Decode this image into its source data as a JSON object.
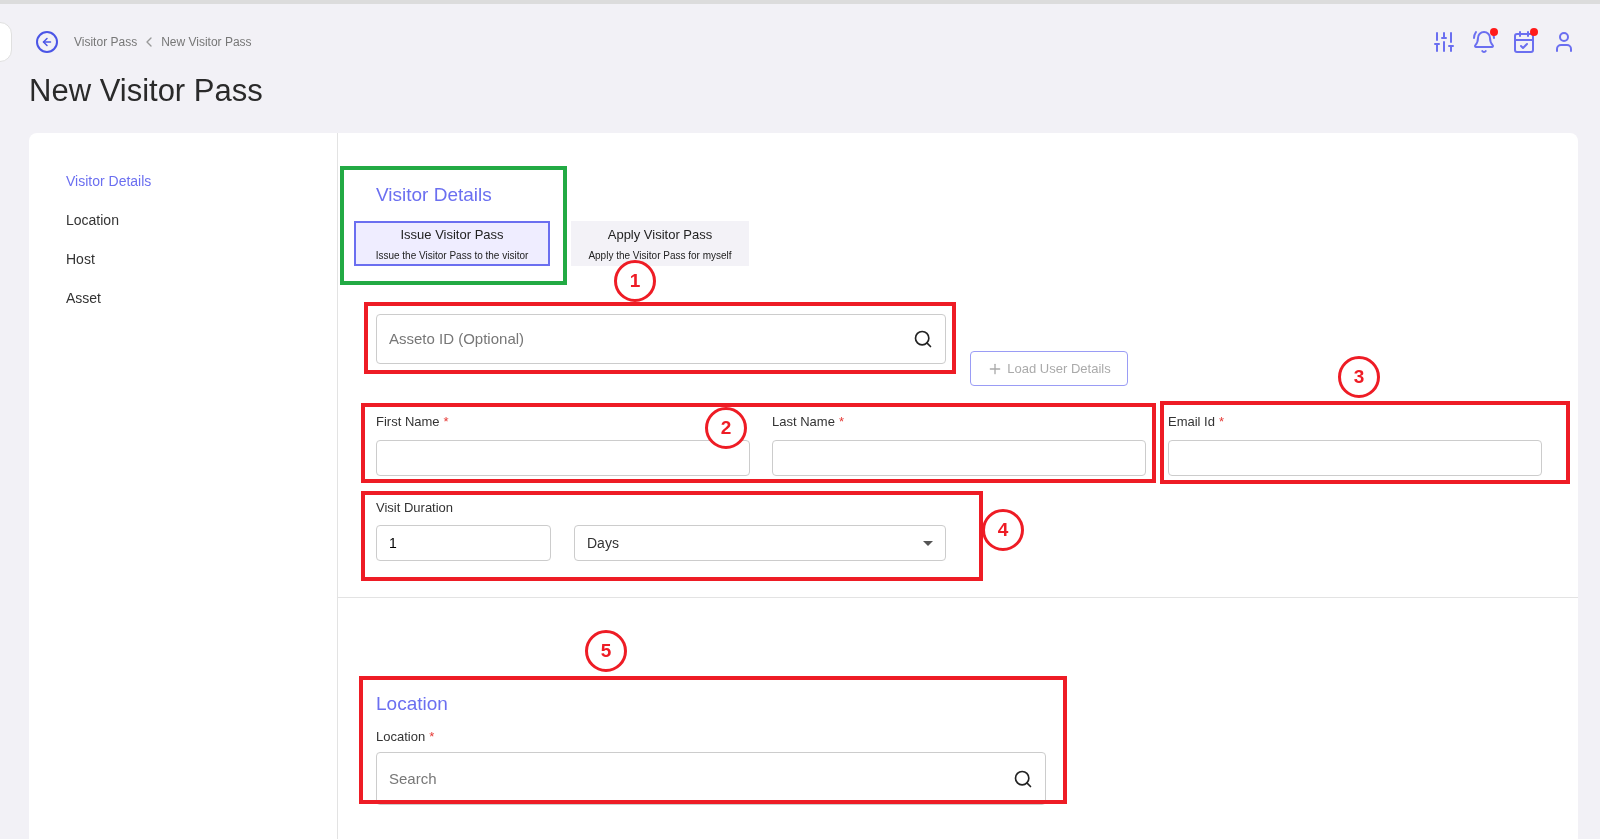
{
  "breadcrumb": [
    "Visitor Pass",
    "New Visitor Pass"
  ],
  "title": "New Visitor Pass",
  "header_icons": [
    {
      "kind": "sliders",
      "dot": false
    },
    {
      "kind": "bell",
      "dot": true
    },
    {
      "kind": "calendar",
      "dot": true
    },
    {
      "kind": "user",
      "dot": false
    }
  ],
  "sidebar": {
    "items": [
      {
        "label": "Visitor Details",
        "selected": true
      },
      {
        "label": "Location",
        "selected": false
      },
      {
        "label": "Host",
        "selected": false
      },
      {
        "label": "Asset",
        "selected": false
      }
    ]
  },
  "visitor_details": {
    "heading": "Visitor Details",
    "tabs": [
      {
        "label": "Issue Visitor Pass",
        "description": "Issue the Visitor Pass to the visitor",
        "selected": true
      },
      {
        "label": "Apply Visitor Pass",
        "description": "Apply the Visitor Pass for myself",
        "selected": false
      }
    ],
    "asseto_field": {
      "placeholder": "Asseto ID (Optional)"
    },
    "load_button": {
      "label": "Load User Details",
      "disabled": true
    },
    "fields": [
      {
        "label": "First Name",
        "required_mark": "*"
      },
      {
        "label": "Last Name",
        "required_mark": "*"
      },
      {
        "label": "Email Id",
        "required_mark": "*"
      }
    ],
    "visit_duration": {
      "label": "Visit Duration",
      "value": "1",
      "unit": "Days"
    }
  },
  "location": {
    "heading": "Location",
    "field_label": "Location",
    "required_mark": "*",
    "placeholder": "Search"
  },
  "annotations": [
    {
      "kind": "box",
      "color": "#22aa44"
    },
    {
      "kind": "box",
      "color": "#ee1c25",
      "marker": "1"
    },
    {
      "kind": "box",
      "color": "#ee1c25",
      "marker": "2"
    },
    {
      "kind": "box",
      "color": "#ee1c25",
      "marker": "3"
    },
    {
      "kind": "box",
      "color": "#ee1c25",
      "marker": "4"
    },
    {
      "kind": "box",
      "color": "#ee1c25",
      "marker": "5"
    }
  ]
}
